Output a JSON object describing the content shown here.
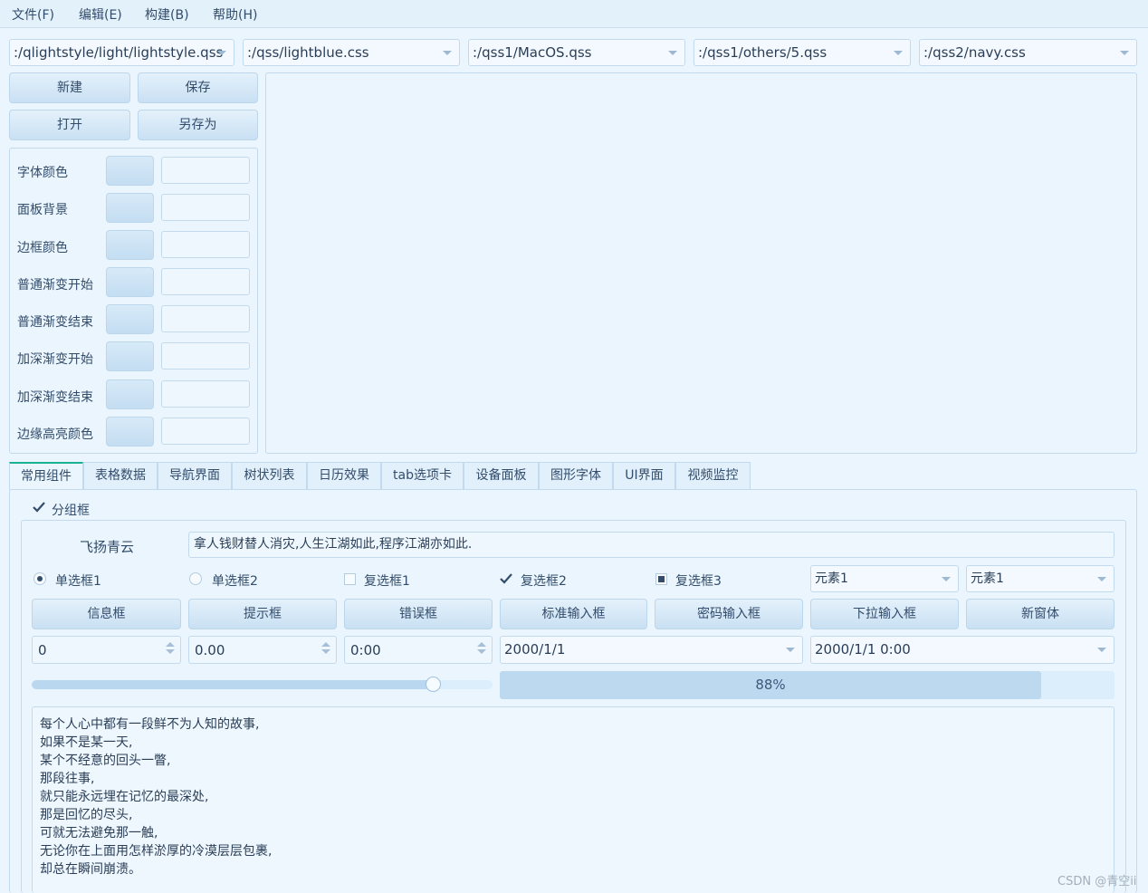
{
  "menu": [
    "文件(F)",
    "编辑(E)",
    "构建(B)",
    "帮助(H)"
  ],
  "style_combos": [
    ":/qlightstyle/light/lightstyle.qss",
    ":/qss/lightblue.css",
    ":/qss1/MacOS.qss",
    ":/qss1/others/5.qss",
    ":/qss2/navy.css"
  ],
  "file_buttons": {
    "new": "新建",
    "save": "保存",
    "open": "打开",
    "save_as": "另存为"
  },
  "color_rows": [
    "字体颜色",
    "面板背景",
    "边框颜色",
    "普通渐变开始",
    "普通渐变结束",
    "加深渐变开始",
    "加深渐变结束",
    "边缘高亮颜色"
  ],
  "tabs": [
    "常用组件",
    "表格数据",
    "导航界面",
    "树状列表",
    "日历效果",
    "tab选项卡",
    "设备面板",
    "图形字体",
    "UI界面",
    "视频监控"
  ],
  "group": {
    "title": "分组框",
    "checked": true,
    "name_label": "飞扬青云",
    "line_edit_value": "拿人钱财替人消灾,人生江湖如此,程序江湖亦如此.",
    "radio1": "单选框1",
    "radio2": "单选框2",
    "check1": "复选框1",
    "check2": "复选框2",
    "check3": "复选框3",
    "combo1": "元素1",
    "combo2": "元素1",
    "buttons": [
      "信息框",
      "提示框",
      "错误框",
      "标准输入框",
      "密码输入框",
      "下拉输入框",
      "新窗体"
    ],
    "spin_int": "0",
    "spin_double": "0.00",
    "time_edit": "0:00",
    "date_edit": "2000/1/1",
    "datetime_edit": "2000/1/1 0:00",
    "slider_fraction": 0.87,
    "progress_text": "88%",
    "progress_fraction": 0.88,
    "text_lines": [
      "每个人心中都有一段鲜不为人知的故事,",
      "如果不是某一天,",
      "某个不经意的回头一瞥,",
      "那段往事,",
      "就只能永远埋在记忆的最深处,",
      "那是回忆的尽头,",
      "可就无法避免那一触,",
      "无论你在上面用怎样淤厚的冷漠层层包裹,",
      "却总在瞬间崩溃。"
    ]
  },
  "watermark": "CSDN @青空ii",
  "colors": {
    "accent": "#19b394",
    "background": "#eaf5fd",
    "border": "#c3daee",
    "progress": "#bcd9f0"
  }
}
